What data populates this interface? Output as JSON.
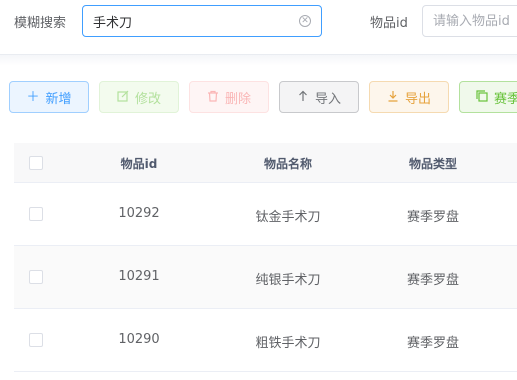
{
  "search": {
    "fuzzy_label": "模糊搜索",
    "fuzzy_value": "手术刀",
    "id_label": "物品id",
    "id_placeholder": "请输入物品id"
  },
  "toolbar": {
    "add_label": "新增",
    "edit_label": "修改",
    "delete_label": "删除",
    "import_label": "导入",
    "export_label": "导出",
    "season_label": "赛季"
  },
  "table": {
    "headers": [
      "物品id",
      "物品名称",
      "物品类型"
    ],
    "rows": [
      {
        "id": "10292",
        "name": "钛金手术刀",
        "type": "赛季罗盘"
      },
      {
        "id": "10291",
        "name": "纯银手术刀",
        "type": "赛季罗盘"
      },
      {
        "id": "10290",
        "name": "粗铁手术刀",
        "type": "赛季罗盘"
      }
    ]
  },
  "icons": {
    "add": "plus-icon",
    "edit": "edit-icon",
    "delete": "trash-icon",
    "import": "upload-arrow-icon",
    "export": "download-icon",
    "season": "copy-icon",
    "clear": "circle-close-icon"
  },
  "colors": {
    "primary": "#409eff",
    "success": "#67c23a",
    "danger": "#f56c6c",
    "warning": "#e6a23c",
    "info": "#909399"
  }
}
